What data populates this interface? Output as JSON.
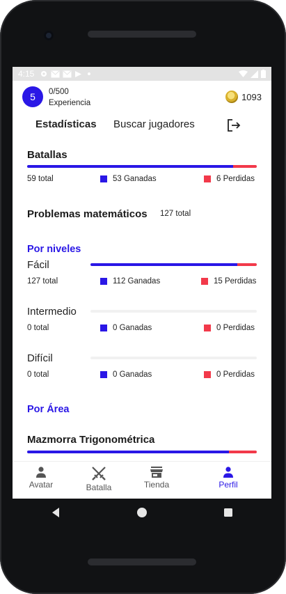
{
  "status": {
    "time": "4:15"
  },
  "header": {
    "level": "5",
    "xp_value": "0/500",
    "xp_label": "Experiencia",
    "coins": "1093"
  },
  "tabs": {
    "stats": "Estadísticas",
    "search": "Buscar jugadores"
  },
  "battles": {
    "title": "Batallas",
    "total": "59 total",
    "won": "53 Ganadas",
    "lost": "6 Perdidas",
    "win_fraction": 0.898
  },
  "math": {
    "title": "Problemas matemáticos",
    "total": "127 total"
  },
  "levels": {
    "heading": "Por niveles",
    "items": [
      {
        "name": "Fácil",
        "total": "127 total",
        "won": "112 Ganadas",
        "lost": "15 Perdidas",
        "win_fraction": 0.882
      },
      {
        "name": "Intermedio",
        "total": "0 total",
        "won": "0 Ganadas",
        "lost": "0 Perdidas",
        "win_fraction": 0
      },
      {
        "name": "Difícil",
        "total": "0 total",
        "won": "0 Ganadas",
        "lost": "0 Perdidas",
        "win_fraction": 0
      }
    ]
  },
  "area": {
    "heading": "Por Área",
    "dungeon": "Mazmorra Trigonométrica",
    "win_fraction": 0.88
  },
  "nav": {
    "avatar": "Avatar",
    "battle": "Batalla",
    "shop": "Tienda",
    "profile": "Perfil"
  },
  "colors": {
    "primary": "#2a17e6",
    "lose": "#f2394a"
  }
}
